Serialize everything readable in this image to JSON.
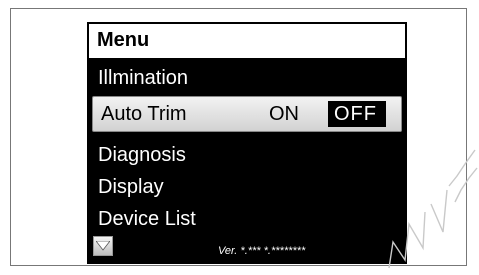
{
  "menu": {
    "title": "Menu",
    "items": [
      {
        "label": "Illmination"
      },
      {
        "label": "Auto Trim",
        "selected": true,
        "options": [
          "ON",
          "OFF"
        ],
        "selected_option": "OFF"
      },
      {
        "label": "Diagnosis"
      },
      {
        "label": "Display"
      },
      {
        "label": "Device List"
      }
    ]
  },
  "footer": {
    "scroll_icon": "triangle-down-icon",
    "version_text": "Ver. *.*** *.********"
  },
  "colors": {
    "screen_bg": "#000000",
    "header_bg": "#ffffff",
    "selected_row_bg": "#e6e6e6",
    "text_light": "#ffffff"
  }
}
